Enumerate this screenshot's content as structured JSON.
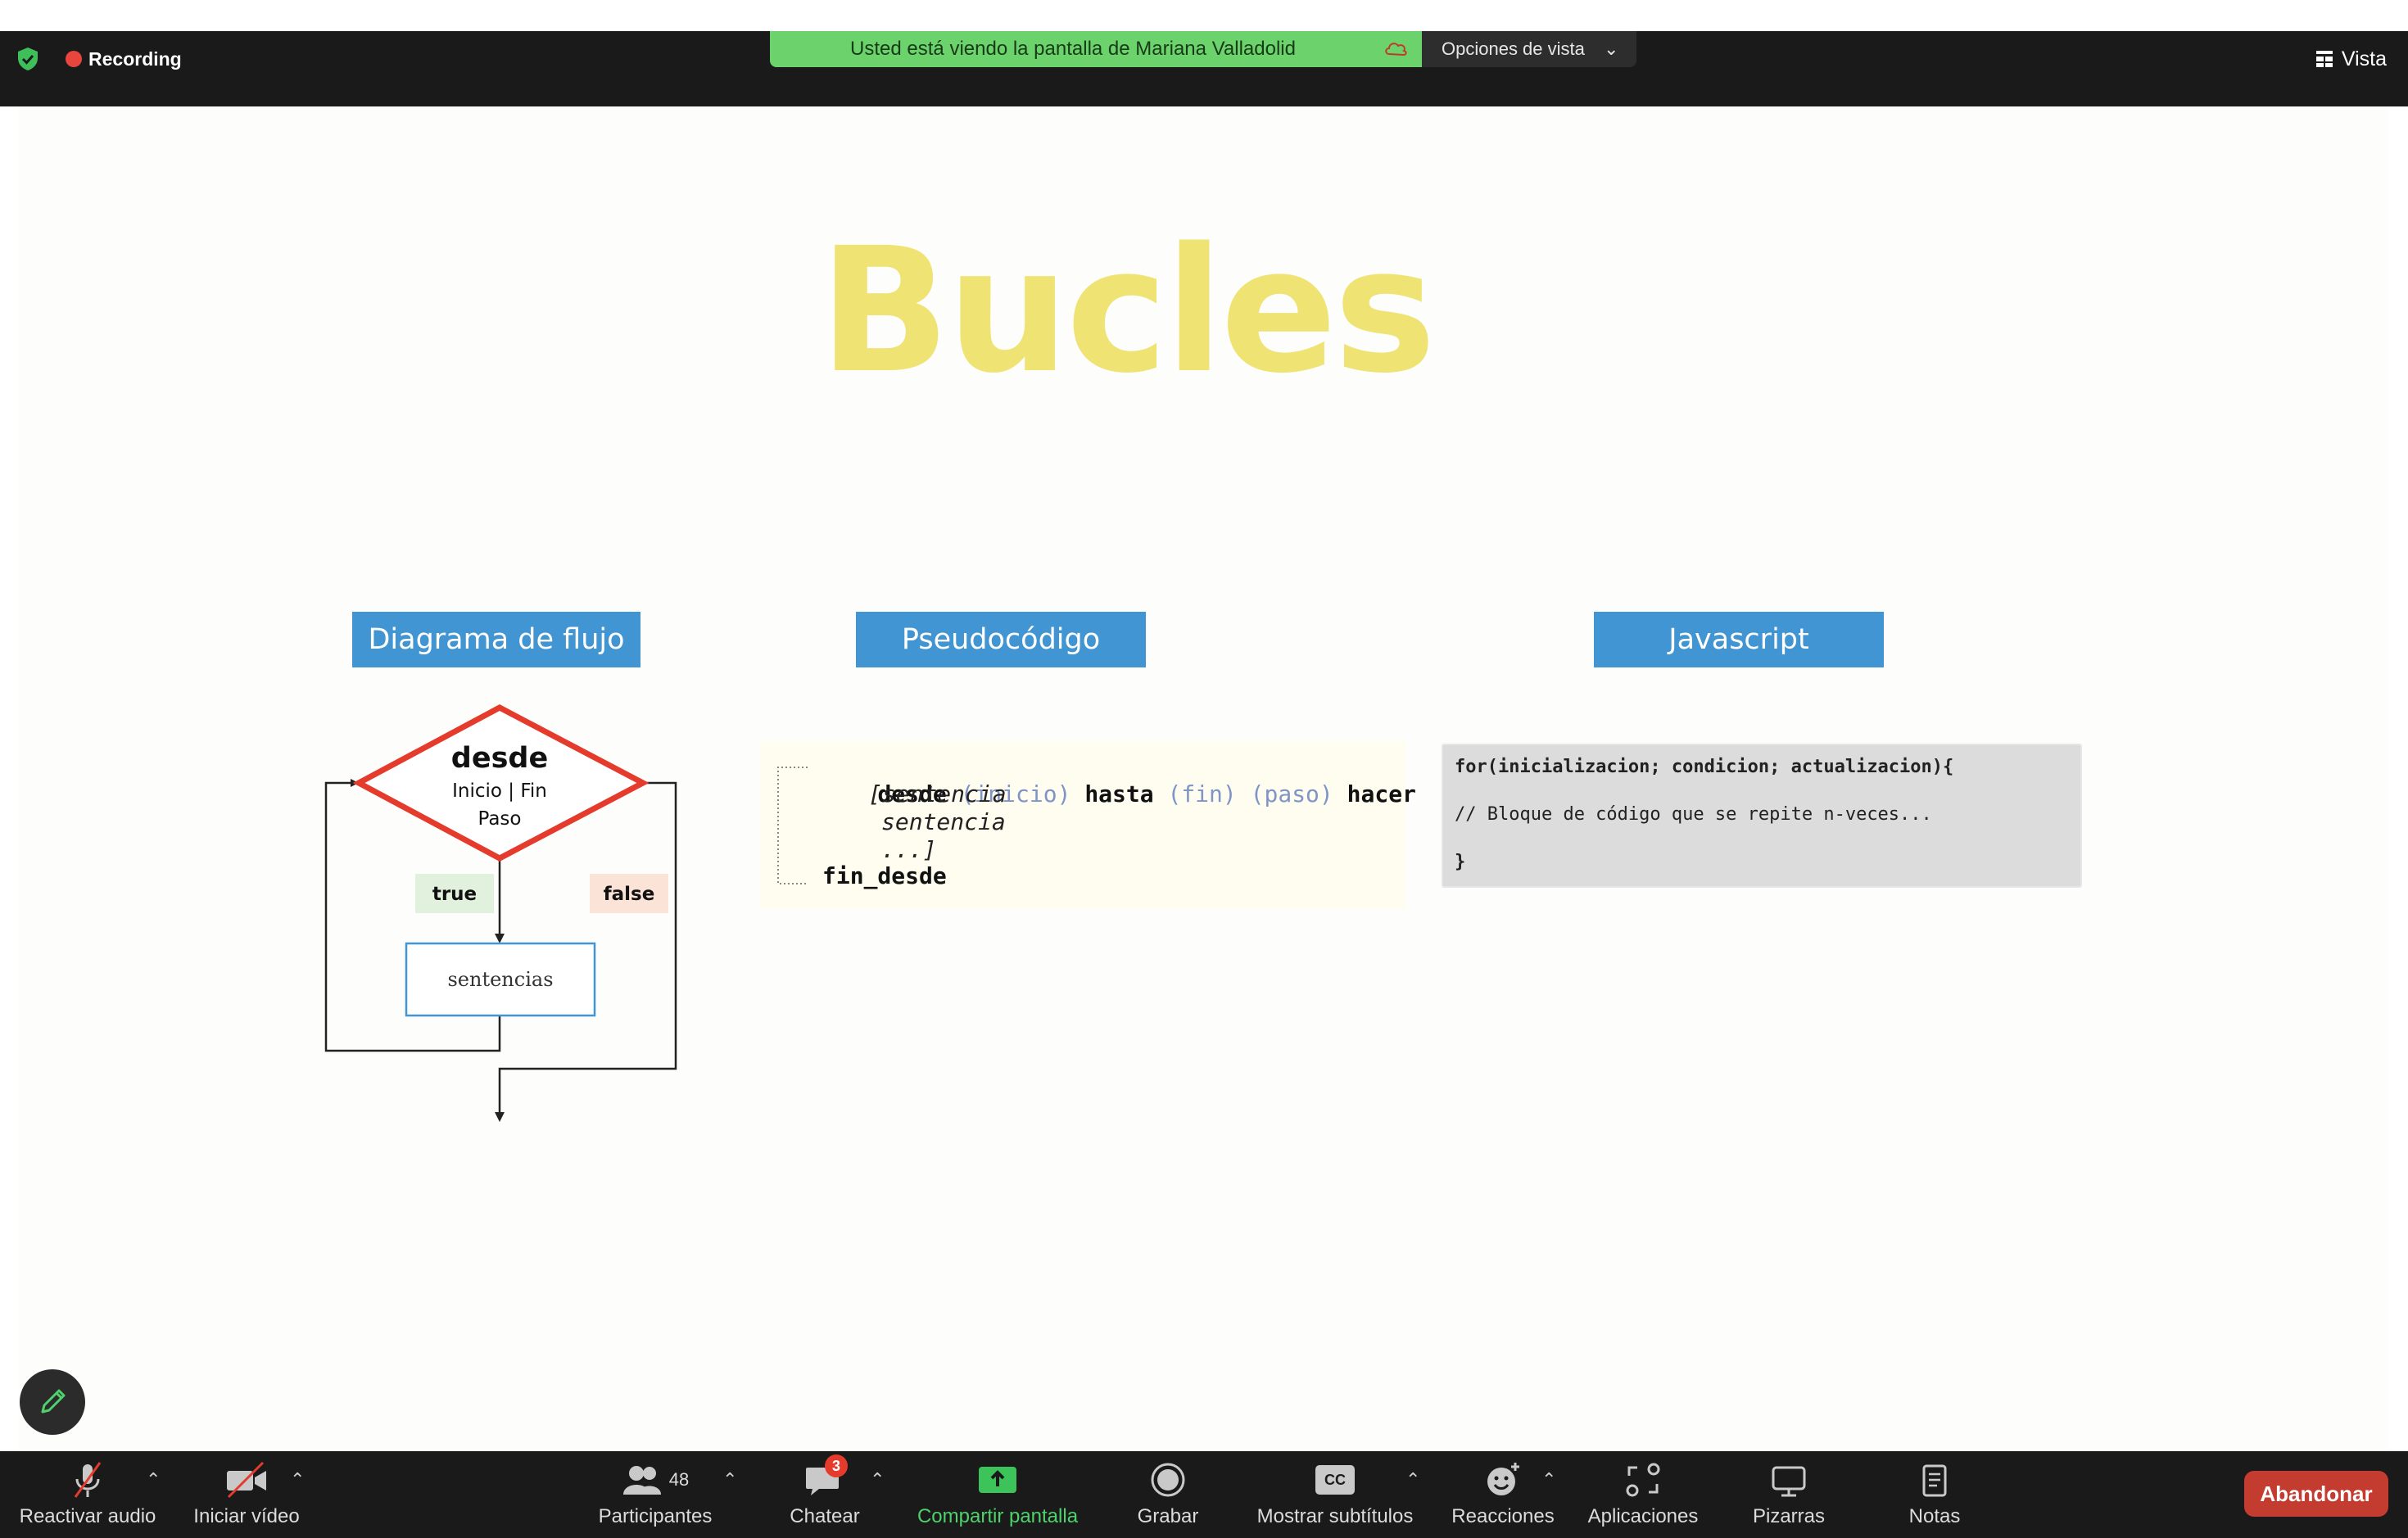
{
  "top_bar": {
    "recording_label": "Recording",
    "share_banner": "Usted está viendo la pantalla de Mariana Valladolid",
    "view_options_label": "Opciones de vista",
    "view_label": "Vista"
  },
  "slide": {
    "title": "Bucles",
    "headers": [
      "Diagrama de flujo",
      "Pseudocódigo",
      "Javascript"
    ],
    "flowchart": {
      "decision_title": "desde",
      "decision_line1": "Inicio | Fin",
      "decision_line2": "Paso",
      "true_label": "true",
      "false_label": "false",
      "process_label": "sentencias"
    },
    "pseudocode": {
      "desde": "desde",
      "inicio": "(inicio)",
      "hasta": "hasta",
      "fin": "(fin)",
      "paso": "(paso)",
      "hacer": "hacer",
      "line2": "[sentencia",
      "line3": "sentencia",
      "line4": "...]",
      "fin_desde": "fin_desde"
    },
    "javascript": {
      "line1": "for(inicializacion; condicion; actualizacion){",
      "line2": "// Bloque de código que se repite n-veces...",
      "line3": "}"
    }
  },
  "toolbar": {
    "reactivar_audio": "Reactivar audio",
    "iniciar_video": "Iniciar vídeo",
    "participantes": "Participantes",
    "participant_count": "48",
    "chatear": "Chatear",
    "chat_badge": "3",
    "compartir_pantalla": "Compartir pantalla",
    "grabar": "Grabar",
    "mostrar_subtitulos": "Mostrar subtítulos",
    "cc_icon_text": "CC",
    "reacciones": "Reacciones",
    "aplicaciones": "Aplicaciones",
    "pizarras": "Pizarras",
    "notas": "Notas",
    "abandonar": "Abandonar"
  },
  "colors": {
    "share_banner": "#6cd36c",
    "slide_title": "#efe373",
    "header_blue": "#4195d2",
    "decision_red": "#e53b2c",
    "leave_red": "#c43b30",
    "share_green": "#3cc35a"
  }
}
